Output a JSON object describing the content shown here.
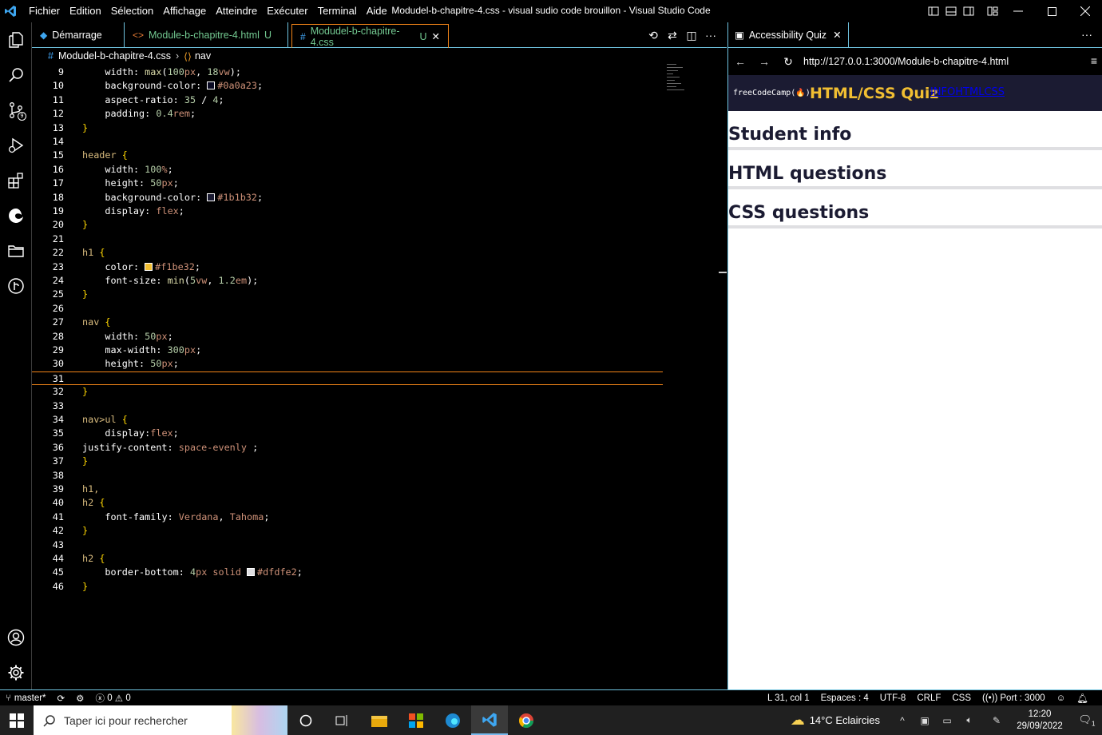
{
  "window": {
    "title": "Modudel-b-chapitre-4.css - visual sudio code brouillon - Visual Studio Code",
    "menu": [
      "Fichier",
      "Edition",
      "Sélection",
      "Affichage",
      "Atteindre",
      "Exécuter",
      "Terminal",
      "Aide"
    ]
  },
  "activitybar": {
    "items": [
      "explorer-icon",
      "search-icon",
      "source-control-icon",
      "run-debug-icon",
      "extensions-icon",
      "edge-icon",
      "folder-icon",
      "git-graph-icon"
    ],
    "scm_badge": "9",
    "bottom": [
      "account-icon",
      "settings-gear-icon"
    ]
  },
  "tabs": [
    {
      "label": "Démarrage",
      "icon": "vscode-icon",
      "modified": ""
    },
    {
      "label": "Module-b-chapitre-4.html",
      "icon": "html-icon",
      "modified": "U"
    },
    {
      "label": "Modudel-b-chapitre-4.css",
      "icon": "css-icon",
      "modified": "U",
      "active": true
    }
  ],
  "breadcrumb": {
    "file": "Modudel-b-chapitre-4.css",
    "symbol": "nav"
  },
  "editor": {
    "cursor_line": 31,
    "lines": [
      {
        "n": "9",
        "text": "    width: max(100px, 18vw);"
      },
      {
        "n": "10",
        "text": "    background-color: #0a0a23;"
      },
      {
        "n": "11",
        "text": "    aspect-ratio: 35 / 4;"
      },
      {
        "n": "12",
        "text": "    padding: 0.4rem;"
      },
      {
        "n": "13",
        "text": "}"
      },
      {
        "n": "14",
        "text": ""
      },
      {
        "n": "15",
        "text": "header {"
      },
      {
        "n": "16",
        "text": "    width: 100%;"
      },
      {
        "n": "17",
        "text": "    height: 50px;"
      },
      {
        "n": "18",
        "text": "    background-color: #1b1b32;"
      },
      {
        "n": "19",
        "text": "    display: flex;"
      },
      {
        "n": "20",
        "text": "}"
      },
      {
        "n": "21",
        "text": ""
      },
      {
        "n": "22",
        "text": "h1 {"
      },
      {
        "n": "23",
        "text": "    color: #f1be32;"
      },
      {
        "n": "24",
        "text": "    font-size: min(5vw, 1.2em);"
      },
      {
        "n": "25",
        "text": "}"
      },
      {
        "n": "26",
        "text": ""
      },
      {
        "n": "27",
        "text": "nav {"
      },
      {
        "n": "28",
        "text": "    width: 50px;"
      },
      {
        "n": "29",
        "text": "    max-width: 300px;"
      },
      {
        "n": "30",
        "text": "    height: 50px;"
      },
      {
        "n": "31",
        "text": ""
      },
      {
        "n": "32",
        "text": "}"
      },
      {
        "n": "33",
        "text": ""
      },
      {
        "n": "34",
        "text": "nav>ul {"
      },
      {
        "n": "35",
        "text": "    display:flex;"
      },
      {
        "n": "36",
        "text": "justify-content: space-evenly ;"
      },
      {
        "n": "37",
        "text": "}"
      },
      {
        "n": "38",
        "text": ""
      },
      {
        "n": "39",
        "text": "h1,"
      },
      {
        "n": "40",
        "text": "h2 {"
      },
      {
        "n": "41",
        "text": "    font-family: Verdana, Tahoma;"
      },
      {
        "n": "42",
        "text": "}"
      },
      {
        "n": "43",
        "text": ""
      },
      {
        "n": "44",
        "text": "h2 {"
      },
      {
        "n": "45",
        "text": "    border-bottom: 4px solid #dfdfe2;"
      },
      {
        "n": "46",
        "text": "}"
      }
    ]
  },
  "preview": {
    "tab_label": "Accessibility Quiz",
    "url": "http://127.0.0.1:3000/Module-b-chapitre-4.html",
    "fcc_logo": "freeCodeCamp(🔥)",
    "h1": "HTML/CSS Quiz",
    "nav_links": "INFOHTMLCSS",
    "sections": [
      "Student info",
      "HTML questions",
      "CSS questions"
    ],
    "colors": {
      "header_bg": "#1b1b32",
      "h1": "#f1be32",
      "border": "#dfdfe2"
    }
  },
  "statusbar": {
    "branch": "master*",
    "errors": "0",
    "warnings": "0",
    "position": "L 31, col 1",
    "spaces": "Espaces : 4",
    "encoding": "UTF-8",
    "eol": "CRLF",
    "language": "CSS",
    "port": "Port : 3000"
  },
  "taskbar": {
    "search_placeholder": "Taper ici pour rechercher",
    "weather": "14°C  Eclaircies",
    "time": "12:20",
    "date": "29/09/2022",
    "notifications": "1"
  }
}
